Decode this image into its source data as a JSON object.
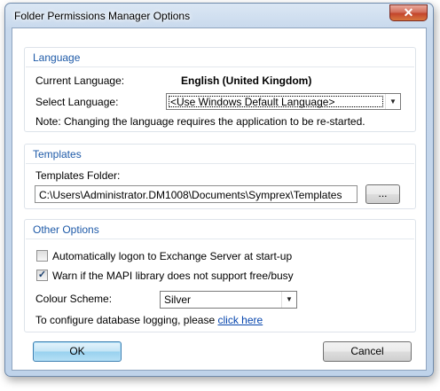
{
  "window": {
    "title": "Folder Permissions Manager Options",
    "close_glyph": "✕"
  },
  "language": {
    "group_title": "Language",
    "current_label": "Current Language:",
    "current_value": "English (United Kingdom)",
    "select_label": "Select Language:",
    "select_value": "<Use Windows Default Language>",
    "note": "Note: Changing the language requires the application to be re-started."
  },
  "templates": {
    "group_title": "Templates",
    "folder_label": "Templates Folder:",
    "folder_value": "C:\\Users\\Administrator.DM1008\\Documents\\Symprex\\Templates",
    "browse_label": "..."
  },
  "other": {
    "group_title": "Other Options",
    "auto_logon_label": "Automatically logon to Exchange Server at start-up",
    "auto_logon_checked": false,
    "mapi_warn_label": "Warn if the MAPI library does not support free/busy",
    "mapi_warn_checked": true,
    "colour_scheme_label": "Colour Scheme:",
    "colour_scheme_value": "Silver",
    "logging_text": "To configure database logging, please",
    "logging_link": "click here"
  },
  "buttons": {
    "ok_label": "OK",
    "cancel_label": "Cancel"
  },
  "icons": {
    "dropdown": "chevron-down-icon",
    "check": "checkmark-icon",
    "close": "close-icon"
  },
  "colors": {
    "group_title": "#1e5aa8",
    "close_button": "#c3452c",
    "link": "#0645ad"
  }
}
